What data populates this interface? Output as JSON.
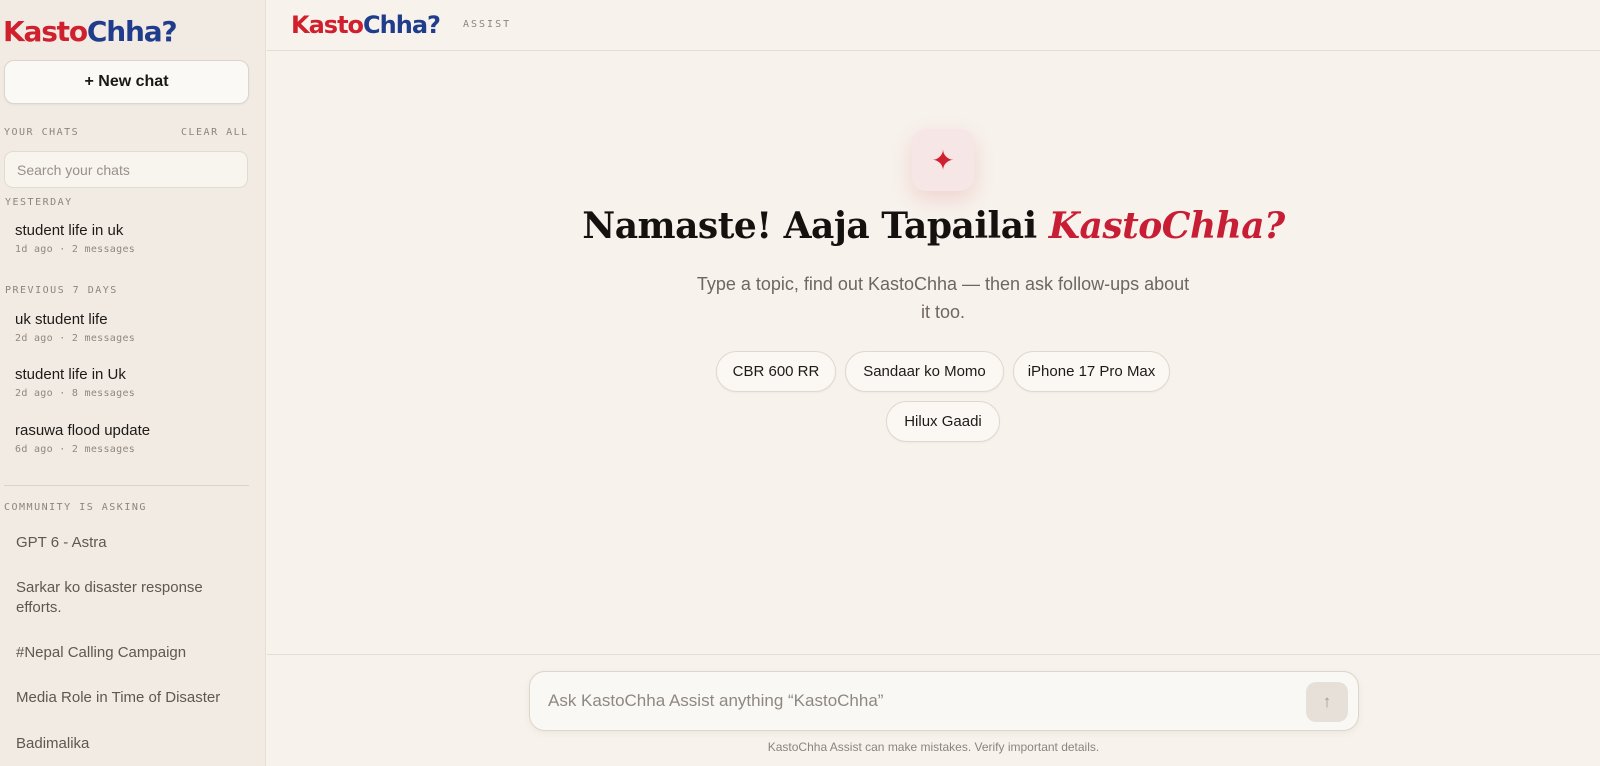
{
  "brand": {
    "part1": "Kasto",
    "part2": "Chha?",
    "tag": "ASSIST"
  },
  "sidebar": {
    "new_chat_label": "+ New chat",
    "your_chats_label": "YOUR CHATS",
    "clear_all_label": "CLEAR ALL",
    "search_placeholder": "Search your chats",
    "groups": [
      {
        "label": "YESTERDAY",
        "items": [
          {
            "title": "student life in uk",
            "meta": "1d ago · 2 messages"
          }
        ]
      },
      {
        "label": "PREVIOUS 7 DAYS",
        "items": [
          {
            "title": "uk student life",
            "meta": "2d ago · 2 messages"
          },
          {
            "title": "student life in Uk",
            "meta": "2d ago · 8 messages"
          },
          {
            "title": "rasuwa flood update",
            "meta": "6d ago · 2 messages"
          }
        ]
      }
    ],
    "community_label": "COMMUNITY IS ASKING",
    "community_items": [
      "GPT 6 - Astra",
      "Sarkar ko disaster response efforts.",
      "#Nepal Calling Campaign",
      "Media Role in Time of Disaster",
      "Badimalika"
    ]
  },
  "main": {
    "icon": "sparkle-icon",
    "headline_plain": "Namaste! Aaja Tapailai ",
    "headline_accent": "KastoChha?",
    "subline": "Type a topic, find out KastoChha — then ask follow-ups about it too.",
    "suggestions": [
      "CBR 600 RR",
      "Sandaar ko Momo",
      "iPhone 17 Pro Max",
      "Hilux Gaadi"
    ]
  },
  "composer": {
    "placeholder": "Ask KastoChha Assist anything “KastoChha”",
    "send_icon": "↑",
    "disclaimer": "KastoChha Assist can make mistakes. Verify important details."
  },
  "colors": {
    "brand_red": "#d0202e",
    "brand_blue": "#1f3d8c",
    "background": "#f7f2ec"
  }
}
